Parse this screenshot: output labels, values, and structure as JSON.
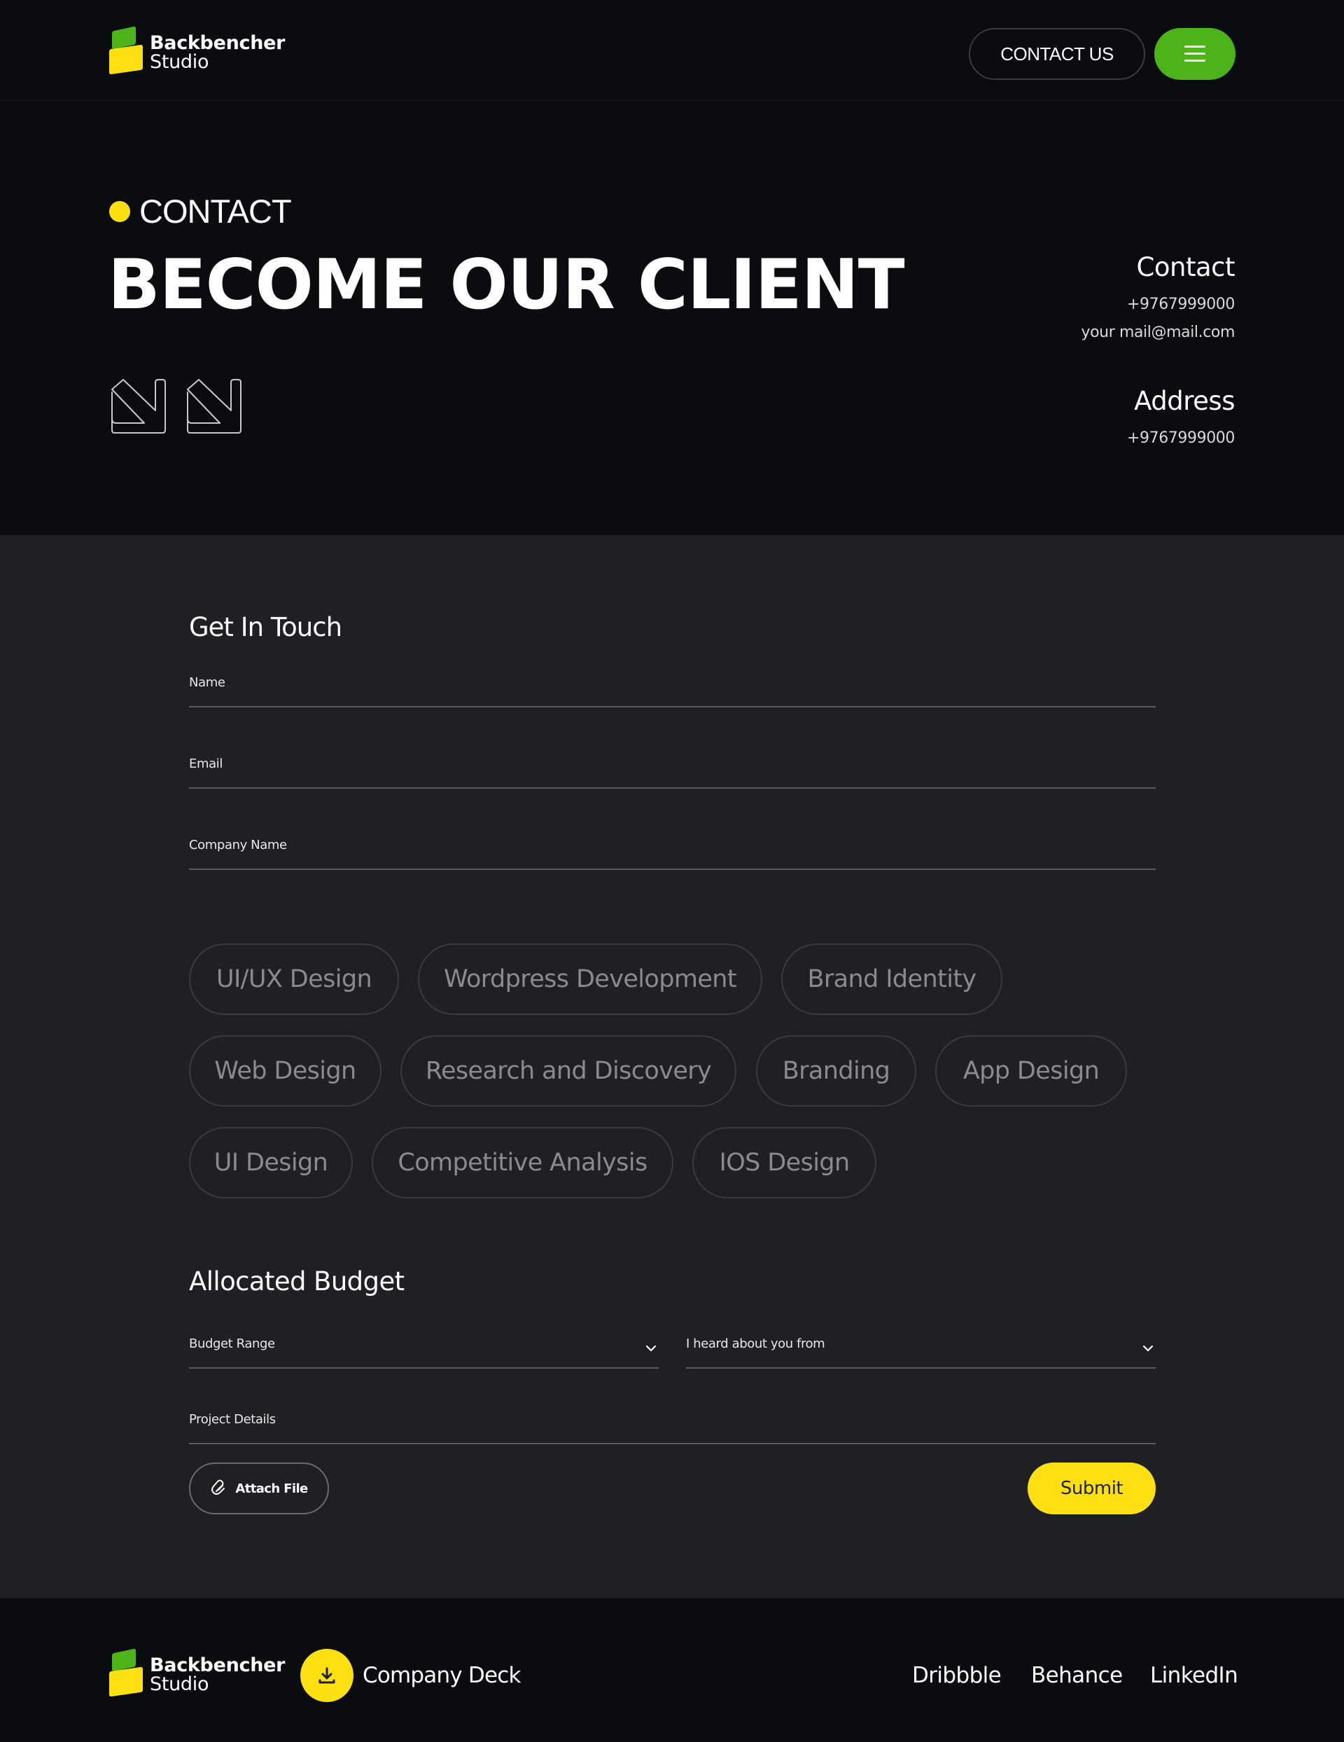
{
  "brand": {
    "line1": "Backbencher",
    "line2": "Studio"
  },
  "header": {
    "contact_button": "CONTACT US",
    "menu_icon": "hamburger-icon"
  },
  "hero": {
    "eyebrow": "CONTACT",
    "title": "BECOME OUR CLIENT",
    "contact": {
      "heading": "Contact",
      "phone": "+9767999000",
      "email": "your mail@mail.com"
    },
    "address": {
      "heading": "Address",
      "value": "+9767999000"
    }
  },
  "form": {
    "get_in_touch": "Get In Touch",
    "fields": {
      "name": "Name",
      "email": "Email",
      "company": "Company Name"
    },
    "services": [
      "UI/UX Design",
      "Wordpress Development",
      "Brand Identity",
      "Web Design",
      "Research and Discovery",
      "Branding",
      "App Design",
      "UI Design",
      "Competitive Analysis",
      "IOS Design"
    ],
    "budget_title": "Allocated Budget",
    "budget_range": "Budget Range",
    "heard_from": "I heard about you from",
    "project_details": "Project Details",
    "attach_label": "Attach File",
    "submit_label": "Submit"
  },
  "footer": {
    "deck_label": "Company Deck",
    "links": [
      "Dribbble",
      "Behance",
      "LinkedIn"
    ]
  },
  "colors": {
    "accent_green": "#4cb318",
    "accent_yellow": "#fde011",
    "bg_dark": "#0b0c10",
    "bg_form": "#1f2023"
  }
}
